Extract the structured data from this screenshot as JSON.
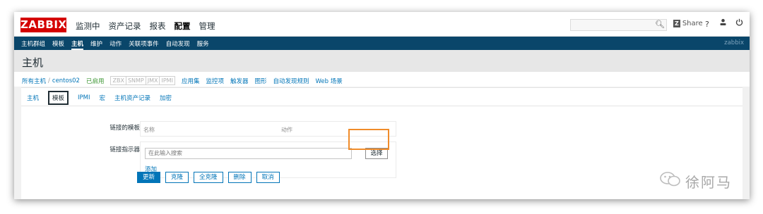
{
  "topbar": {
    "logo": "ZABBIX",
    "menu": [
      "监测中",
      "资产记录",
      "报表",
      "配置",
      "管理"
    ],
    "active_menu": "配置",
    "share_label": "Share",
    "share_badge": "Z",
    "help": "?",
    "icons": {
      "search": "search-icon",
      "user": "user-icon",
      "power": "power-icon"
    }
  },
  "submenu": {
    "items": [
      "主机群组",
      "模板",
      "主机",
      "维护",
      "动作",
      "关联项事件",
      "自动发现",
      "服务"
    ],
    "brand": "zabbix"
  },
  "page": {
    "title": "主机"
  },
  "breadcrumb": {
    "all_hosts": "所有主机",
    "sep": "/",
    "host": "centos02",
    "status": "已启用",
    "interfaces": [
      "ZBX",
      "SNMP",
      "JMX",
      "IPMI"
    ],
    "links": [
      "应用集",
      "监控项",
      "触发器",
      "图形",
      "自动发现规则",
      "Web 场景"
    ]
  },
  "tabs": [
    "主机",
    "模板",
    "IPMI",
    "宏",
    "主机资产记录",
    "加密"
  ],
  "active_tab": "模板",
  "form": {
    "linked_templates_label": "链接的模板",
    "col_name": "名称",
    "col_action": "动作",
    "link_indicator_label": "链接指示器",
    "search_placeholder": "在此输入搜索",
    "select_button": "选择",
    "add_link": "添加"
  },
  "actions": [
    "更新",
    "克隆",
    "全克隆",
    "删除",
    "取消"
  ],
  "watermark": "徐阿马",
  "colors": {
    "brand": "#d40000",
    "nav": "#0a466a",
    "link": "#0275b8",
    "highlight": "#f08c2a",
    "enabled": "#3c9633"
  }
}
